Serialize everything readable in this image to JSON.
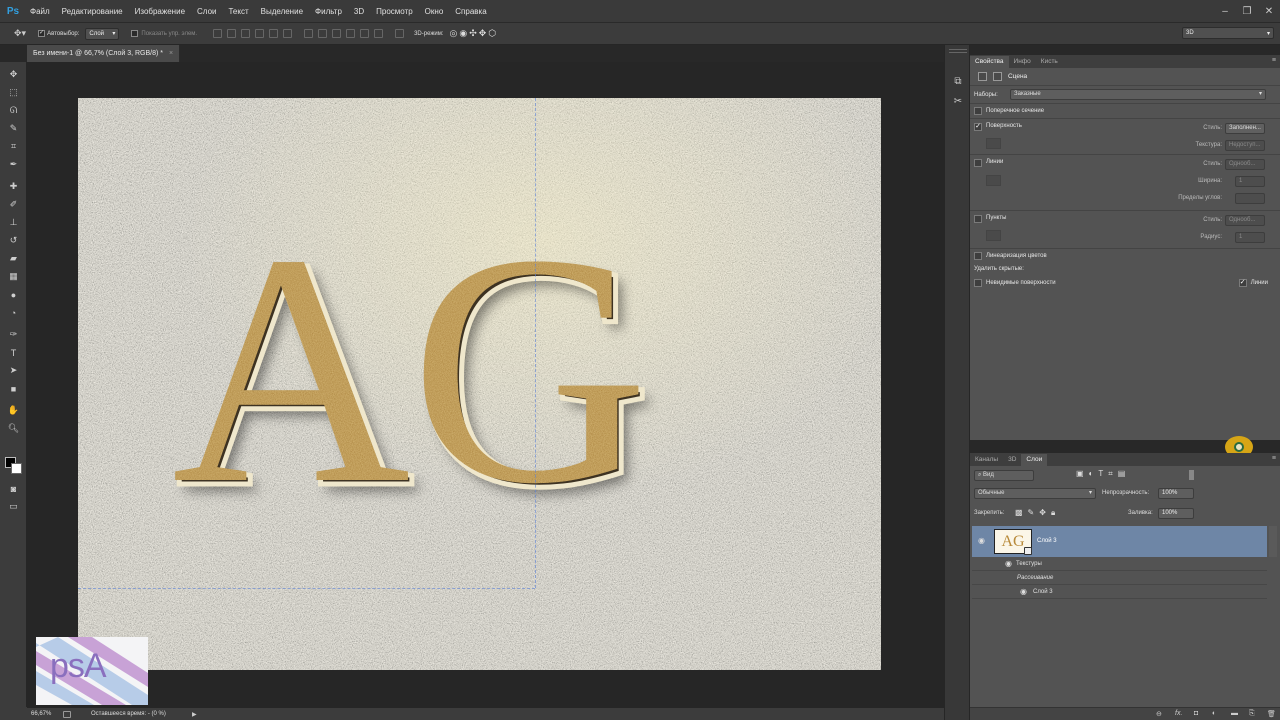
{
  "app": {
    "logo": "Ps"
  },
  "menu": [
    "Файл",
    "Редактирование",
    "Изображение",
    "Слои",
    "Текст",
    "Выделение",
    "Фильтр",
    "3D",
    "Просмотр",
    "Окно",
    "Справка"
  ],
  "options": {
    "autoselect": "Автовыбор:",
    "autoselect_value": "Слой",
    "show_controls": "Показать упр. элем.",
    "mode_3d": "3D-режим:",
    "workspace": "3D"
  },
  "document": {
    "tab_title": "Без имени-1 @ 66,7% (Слой 3, RGB/8) *",
    "text": "AG"
  },
  "status": {
    "zoom": "66,67%",
    "efficiency": "Оставшееся время: - (0 %)"
  },
  "properties": {
    "tabs": [
      "Свойства",
      "Инфо",
      "Кисть"
    ],
    "scene_label": "Сцена",
    "presets_label": "Наборы:",
    "presets_value": "Заказные",
    "cross_section": "Поперечное сечение",
    "surface": "Поверхность",
    "surface_style_label": "Стиль:",
    "surface_style_value": "Заполнен...",
    "texture_label": "Текстура:",
    "texture_value": "Недоступ...",
    "lines": "Линии",
    "lines_style_label": "Стиль:",
    "lines_style_value": "Однооб...",
    "width_label": "Ширина:",
    "width_value": "1",
    "angle_label": "Пределы углов:",
    "points": "Пункты",
    "points_style_label": "Стиль:",
    "points_style_value": "Однооб...",
    "radius_label": "Радиус:",
    "radius_value": "1",
    "linearize": "Линеаризация цветов",
    "remove_hidden": "Удалить скрытые:",
    "hidden_surfaces": "Невидимые поверхности",
    "hidden_lines": "Линии"
  },
  "layers": {
    "tabs": [
      "Каналы",
      "3D",
      "Слои"
    ],
    "filter": "Вид",
    "blend": "Обычные",
    "opacity_label": "Непрозрачность:",
    "opacity_value": "100%",
    "lock_label": "Закрепить:",
    "fill_label": "Заливка:",
    "fill_value": "100%",
    "layer_name": "Слой 3",
    "thumb_text": "AG",
    "textures": "Текстуры",
    "diffuse": "Рассеивание",
    "sublayer": "Слой 3"
  },
  "watermark": {
    "text": "psA"
  }
}
